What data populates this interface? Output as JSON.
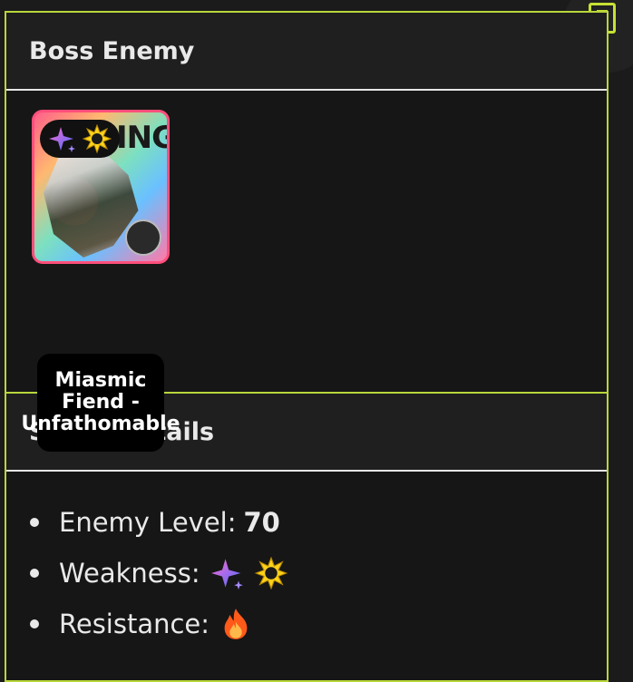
{
  "boss": {
    "heading": "Boss Enemy",
    "card": {
      "name": "Miasmic Fiend - Unfathomable",
      "card_text": "ING",
      "badge_icons": [
        "imaginary-element-icon",
        "quantum-element-icon"
      ]
    }
  },
  "stage": {
    "heading": "Stage Details",
    "enemy_level_label": "Enemy Level:",
    "enemy_level_value": "70",
    "weakness_label": "Weakness:",
    "weakness_icons": [
      "imaginary-element-icon",
      "quantum-element-icon"
    ],
    "resistance_label": "Resistance:",
    "resistance_icons": [
      "fire-element-icon"
    ]
  },
  "colors": {
    "accent": "#b8d63a",
    "panel_bg": "#161616",
    "header_bg": "#1f1f1f"
  },
  "toc_button": {
    "icon": "table-of-contents-icon"
  }
}
